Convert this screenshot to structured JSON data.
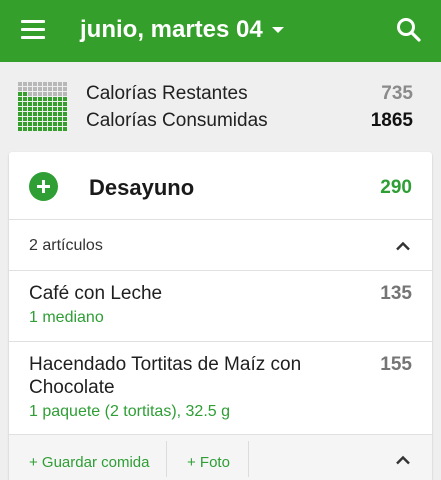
{
  "app": {
    "date_title": "junio, martes 04",
    "menu_icon": "hamburger-menu-icon",
    "search_icon": "search-icon",
    "dropdown_icon": "caret-down-icon",
    "accent_color": "#34a02b"
  },
  "summary": {
    "remaining_label": "Calorías Restantes",
    "remaining_value": "735",
    "consumed_label": "Calorías Consumidas",
    "consumed_value": "1865",
    "consumed_fraction": 0.72
  },
  "meal": {
    "title": "Desayuno",
    "calories": "290",
    "items_count_label": "2 artículos",
    "items": [
      {
        "name": "Café con Leche",
        "portion": "1 mediano",
        "calories": "135"
      },
      {
        "name": "Hacendado Tortitas de Maíz con Chocolate",
        "portion": "1 paquete (2 tortitas), 32.5 g",
        "calories": "155"
      }
    ],
    "actions": {
      "save_meal": "+ Guardar comida",
      "photo": "+ Foto"
    }
  }
}
